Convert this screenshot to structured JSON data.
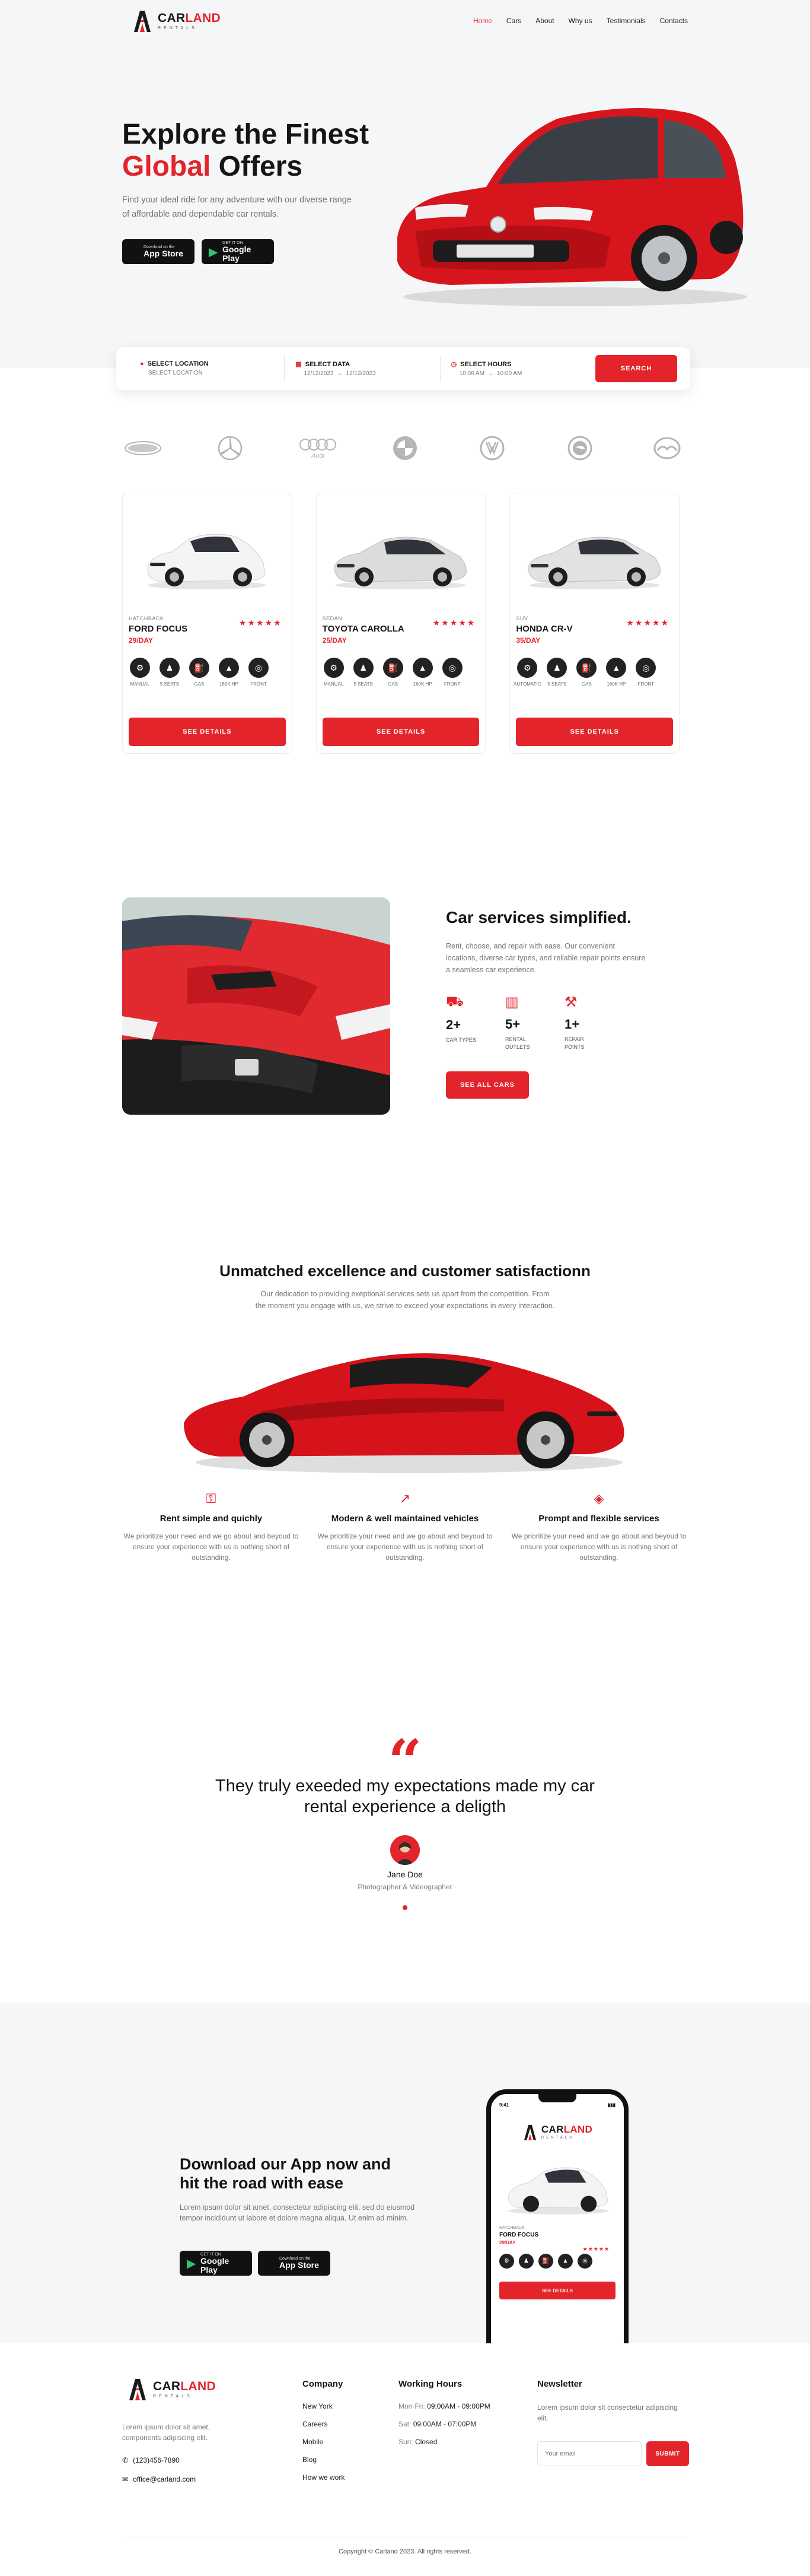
{
  "brand": {
    "name_part1": "CAR",
    "name_part2": "LAND",
    "tagline": "RENTALS"
  },
  "nav": {
    "items": [
      "Home",
      "Cars",
      "About",
      "Why us",
      "Testimonials",
      "Contacts"
    ],
    "active": "Home"
  },
  "hero": {
    "title_line1": "Explore the Finest",
    "title_accent": "Global",
    "title_rest": " Offers",
    "lead": "Find your ideal ride for any adventure with our diverse range of affordable and dependable car rentals.",
    "app_store": {
      "small": "Download on the",
      "big": "App Store"
    },
    "google_play": {
      "small": "GET IT ON",
      "big": "Google Play"
    }
  },
  "search": {
    "location": {
      "label": "SELECT LOCATION",
      "value": "SELECT LOCATION"
    },
    "date": {
      "label": "SELECT DATA",
      "from": "12/12/2023",
      "to": "12/12/2023"
    },
    "hours": {
      "label": "SELECT HOURS",
      "from": "10:00 AM",
      "to": "10:00 AM"
    },
    "button": "SEARCH"
  },
  "brands": [
    "Ford",
    "Mercedes-Benz",
    "Audi",
    "BMW",
    "Volkswagen",
    "Skoda",
    "Mazda"
  ],
  "cars": [
    {
      "type": "HATCHBACK",
      "name": "FORD FOCUS",
      "price": "29/DAY",
      "stars": "★★★★★",
      "specs": [
        "MANUAL",
        "5 SEATS",
        "GAS",
        "160K HP",
        "FRONT"
      ],
      "button": "SEE DETAILS"
    },
    {
      "type": "SEDAN",
      "name": "TOYOTA CAROLLA",
      "price": "25/DAY",
      "stars": "★★★★★",
      "specs": [
        "MANUAL",
        "5 SEATS",
        "GAS",
        "160K HP",
        "FRONT"
      ],
      "button": "SEE DETAILS"
    },
    {
      "type": "SUV",
      "name": "HONDA CR-V",
      "price": "35/DAY",
      "stars": "★★★★★",
      "specs": [
        "AUTOMATIC",
        "5 SEATS",
        "GAS",
        "160K HP",
        "FRONT"
      ],
      "button": "SEE DETAILS"
    }
  ],
  "services": {
    "title": "Car services simplified.",
    "text": "Rent, choose, and repair with ease. Our convenient locations, diverse car types, and reliable repair points ensure a seamless car experience.",
    "stats": [
      {
        "num": "2+",
        "label": "CAR TYPES"
      },
      {
        "num": "5+",
        "label": "RENTAL OUTLETS"
      },
      {
        "num": "1+",
        "label": "REPAIR POINTS"
      }
    ],
    "button": "SEE ALL CARS"
  },
  "excellence": {
    "title": "Unmatched excellence and customer satisfactionn",
    "subtitle": "Our dedication to providing exeptional services sets us apart from the competition. From the moment you engage with us, we strive to exceed your expectations in every interaction.",
    "features": [
      {
        "title": "Rent simple and quichly",
        "text": "We prioritize your need and we go about and beyoud to ensure your experience with us is nothing short of outstanding."
      },
      {
        "title": "Modern & well maintained vehicles",
        "text": "We prioritize your need and we go about and beyoud to ensure your experience with us is nothing short of outstanding."
      },
      {
        "title": "Prompt and flexible services",
        "text": "We prioritize your need and we go about and beyoud to ensure your experience with us is nothing short of outstanding."
      }
    ]
  },
  "testimonial": {
    "quote": "They truly exeeded my expectations made my car rental experience a deligth",
    "name": "Jane Doe",
    "role": "Photographer & Videographer"
  },
  "download": {
    "title": "Download our App now and hit the road with ease",
    "text": "Lorem ipsum dolor sit amet, consectetur adipiscing elit, sed do eiusmod tempor incididunt ut labore et dolore magna aliqua. Ut enim ad minim.",
    "phone_time": "9:41",
    "phone_car": {
      "type": "HATCHBACK",
      "name": "FORD FOCUS",
      "price": "29/DAY",
      "stars": "★★★★★",
      "button": "SEE DETAILS"
    }
  },
  "footer": {
    "description": "Lorem ipsum dolor sit amet, components adipiscing elit.",
    "phone": "(123)456-7890",
    "email": "office@carland.com",
    "company": {
      "title": "Company",
      "links": [
        "New York",
        "Careers",
        "Mobile",
        "Blog",
        "How we work"
      ]
    },
    "hours": {
      "title": "Working Hours",
      "rows": [
        {
          "day": "Mon-Fri:",
          "time": "09:00AM - 09:00PM"
        },
        {
          "day": "Sat:",
          "time": "09:00AM - 07:00PM"
        },
        {
          "day": "Sun:",
          "time": "Closed"
        }
      ]
    },
    "newsletter": {
      "title": "Newsletter",
      "text": "Lorem ipsum dolor sit consectetur adipiscing elit.",
      "placeholder": "Your email",
      "button": "SUBMIT"
    },
    "copyright": "Copyright © Carland 2023. All rights reserved."
  },
  "colors": {
    "accent": "#e3242b",
    "dark": "#141414",
    "muted": "#777777",
    "section_bg": "#f5f6f8"
  }
}
